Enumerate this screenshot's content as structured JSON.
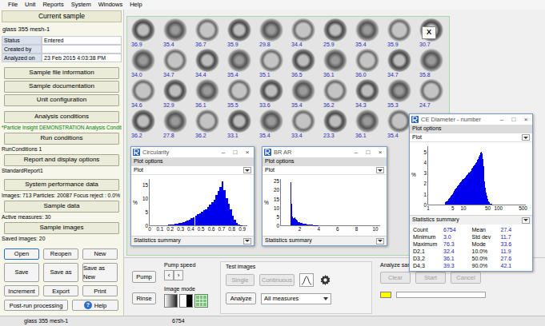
{
  "menu": [
    "File",
    "Unit",
    "Reports",
    "System",
    "Windows",
    "Help"
  ],
  "current_sample": {
    "header": "Current sample",
    "name": "glass 355 mesh-1",
    "fields": [
      [
        "Status",
        "Entered"
      ],
      [
        "Created by",
        ""
      ],
      [
        "Analyzed on",
        "23 Feb 2015  4:03:38 PM"
      ]
    ]
  },
  "left_groups": [
    [
      {
        "kind": "button",
        "text": "Sample file information"
      },
      {
        "kind": "button",
        "text": "Sample documentation"
      },
      {
        "kind": "button",
        "text": "Unit configuration"
      }
    ],
    [
      {
        "kind": "button",
        "text": "Analysis conditions"
      },
      {
        "kind": "note",
        "text": "*Particle Insight DEMONSTRATION Analysis Condit"
      },
      {
        "kind": "button",
        "text": "Run conditions"
      },
      {
        "kind": "info",
        "text": "RunConditions 1"
      },
      {
        "kind": "button",
        "text": "Report and display options"
      },
      {
        "kind": "info",
        "text": "StandardReport1"
      }
    ],
    [
      {
        "kind": "button",
        "text": "System performance data"
      },
      {
        "kind": "info",
        "text": "Images:  713  Particles: 20087  Focus reject : 0.0%"
      },
      {
        "kind": "button",
        "text": "Sample data"
      },
      {
        "kind": "info",
        "text": "Active measures: 30"
      },
      {
        "kind": "button",
        "text": "Sample images"
      },
      {
        "kind": "info",
        "text": "Saved images: 20"
      }
    ]
  ],
  "file_buttons": [
    [
      {
        "label": "Open",
        "focused": true
      },
      {
        "label": "Reopen",
        "focused": false
      },
      {
        "label": "New",
        "focused": false
      }
    ],
    [
      {
        "label": "Save",
        "focused": false
      },
      {
        "label": "Save as",
        "focused": false
      },
      {
        "label": "Save as New",
        "focused": false
      }
    ],
    [
      {
        "label": "Increment",
        "focused": false
      },
      {
        "label": "Export",
        "focused": false
      },
      {
        "label": "Print",
        "focused": false
      }
    ],
    [
      {
        "label": "Post-run processing",
        "focused": false
      },
      {
        "label": "Help",
        "icon": "?",
        "focused": false
      }
    ]
  ],
  "images": {
    "close": "X",
    "rows": [
      [
        "36.9",
        "35.4",
        "36.7",
        "35.9",
        "29.8",
        "34.4",
        "25.9",
        "35.4",
        "35.9",
        "30.7"
      ],
      [
        "34.0",
        "34.7",
        "34.4",
        "35.4",
        "35.1",
        "36.5",
        "36.1",
        "36.0",
        "34.7",
        "35.8"
      ],
      [
        "34.6",
        "32.9",
        "36.1",
        "35.5",
        "33.6",
        "35.4",
        "36.2",
        "34.3",
        "35.3",
        "24.7"
      ],
      [
        "36.2",
        "27.8",
        "36.2",
        "33.1",
        "35.4",
        "33.4",
        "23.3",
        "36.1",
        "35.4"
      ]
    ]
  },
  "windows": [
    {
      "title": "Circularity",
      "controls": [
        "–",
        "□",
        "×"
      ],
      "plot_options": "Plot options",
      "plot": "Plot",
      "y_label": "%",
      "y_ticks": [
        "0",
        "5",
        "10",
        "15"
      ],
      "y_range": [
        0,
        17
      ],
      "x_ticks": [
        "0",
        "0.1",
        "0.2",
        "0.3",
        "0.4",
        "0.5",
        "0.6",
        "0.7",
        "0.8",
        "0.9"
      ],
      "x_range": [
        0,
        0.95
      ],
      "x_log": false,
      "bin_start": 0,
      "bin_width": 0.02,
      "values": [
        0,
        0,
        0,
        0,
        0,
        0,
        0,
        0,
        0,
        0.2,
        0.3,
        0.4,
        0.5,
        0.6,
        0.8,
        1,
        1.2,
        1.5,
        1.8,
        2.2,
        2.5,
        3,
        3.5,
        4,
        4.5,
        5,
        5.5,
        6,
        6.8,
        7.5,
        8.5,
        9.5,
        11,
        12.5,
        14,
        16,
        13,
        10,
        8,
        6,
        3.5,
        2,
        1,
        0.4,
        0.1
      ],
      "footer": "Statistics summary"
    },
    {
      "title": "BR AR",
      "controls": [
        "–",
        "□",
        "×"
      ],
      "plot_options": "Plot options",
      "plot": "Plot",
      "y_label": "%",
      "y_ticks": [
        "0",
        "5",
        "10",
        "15",
        "20",
        "25"
      ],
      "y_range": [
        0,
        26
      ],
      "x_ticks": [
        "2",
        "4",
        "6",
        "8",
        "10"
      ],
      "x_range": [
        0,
        10.5
      ],
      "x_log": false,
      "bin_start": 1,
      "bin_width": 0.1,
      "values": [
        24,
        12,
        5,
        4,
        4.5,
        3.5,
        3,
        2.5,
        2,
        2,
        1.5,
        1.5,
        1.2,
        1,
        1,
        0.8,
        0.7,
        0.6,
        0.5,
        0.5,
        0.4,
        0.3,
        0.3,
        0.3,
        0.2,
        0.2,
        0.2,
        0.1,
        0.1,
        0.1
      ],
      "footer": "Statistics summary"
    },
    {
      "title": "CE Diameter - number",
      "controls": [
        "–",
        "□",
        "×"
      ],
      "plot_options": "Plot options",
      "plot": "Plot",
      "y_label": "%",
      "y_ticks": [
        "0",
        "1",
        "2",
        "3",
        "4",
        "5"
      ],
      "y_range": [
        0,
        5.5
      ],
      "x_ticks": [
        "1",
        "5",
        "10",
        "50",
        "100",
        "500"
      ],
      "x_range": [
        1,
        600
      ],
      "x_log": true,
      "bin_start": 0.48,
      "bin_width": 0.02,
      "values": [
        0.2,
        0.3,
        0.3,
        0.4,
        0.5,
        0.5,
        0.6,
        0.7,
        0.8,
        0.9,
        1.0,
        1.1,
        1.2,
        1.3,
        1.4,
        1.5,
        1.6,
        1.7,
        1.8,
        1.9,
        2.0,
        2.1,
        2.1,
        2.2,
        2.3,
        2.4,
        2.4,
        2.5,
        2.6,
        2.7,
        2.7,
        2.8,
        2.9,
        3.0,
        3.0,
        3.1,
        3.2,
        3.3,
        3.4,
        3.5,
        3.6,
        3.7,
        3.8,
        3.9,
        4.0,
        4.1,
        4.2,
        4.3,
        4.5,
        4.7,
        4.9,
        5.0,
        4.8,
        4.3,
        3.6,
        2.9,
        2.2,
        1.6,
        1.1,
        0.8,
        0.5,
        0.3,
        0.2,
        0.1,
        0.1,
        0.05,
        0.05,
        0,
        0,
        0,
        0
      ],
      "footer": "Statistics summary",
      "stats": [
        [
          "Count",
          "6754",
          "Mean",
          "27.4"
        ],
        [
          "Minimum",
          "3.0",
          "Std dev",
          "11.7"
        ],
        [
          "Maximum",
          "76.3",
          "Mode",
          "33.6"
        ],
        [
          "D2,1",
          "32.4",
          "10.0%",
          "11.9"
        ],
        [
          "D3,2",
          "36.1",
          "50.0%",
          "27.6"
        ],
        [
          "D4,3",
          "39.3",
          "90.0%",
          "42.1"
        ]
      ]
    }
  ],
  "controls": {
    "pump": "Pump",
    "rinse": "Rinse",
    "pump_speed": {
      "label": "Pump speed",
      "arrows": [
        "‹",
        "›"
      ]
    },
    "image_mode": {
      "label": "Image mode"
    },
    "test_images": {
      "label": "Test images",
      "single": {
        "label": "Single",
        "disabled": true
      },
      "continuous": {
        "label": "Continuous",
        "disabled": true
      },
      "analyze": "Analyze",
      "measures": "All measures"
    },
    "analyze_sample": {
      "label": "Analyze sample",
      "buttons": [
        {
          "label": "Clear",
          "disabled": true
        },
        {
          "label": "Start",
          "disabled": true
        },
        {
          "label": "Cancel",
          "disabled": true
        }
      ],
      "progress": {
        "level": 0
      }
    }
  },
  "status_bar": [
    "glass 355 mesh-1",
    "6754"
  ]
}
